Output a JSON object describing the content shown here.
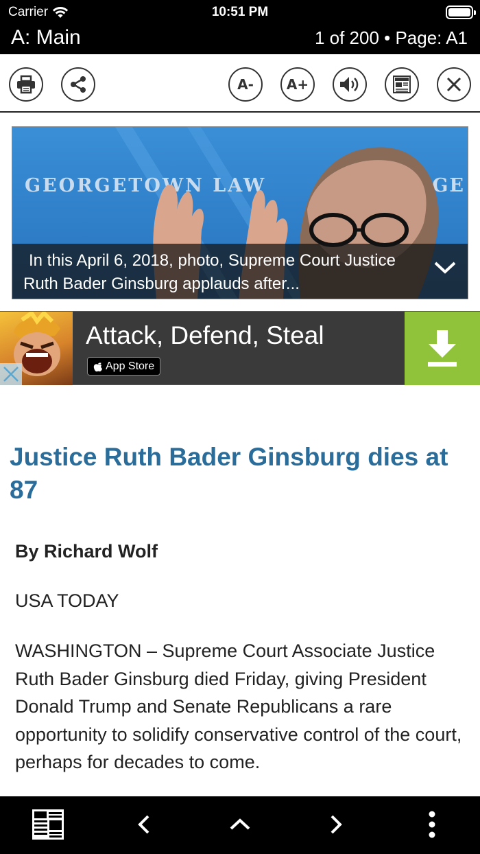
{
  "status_bar": {
    "carrier": "Carrier",
    "time": "10:51 PM"
  },
  "nav": {
    "title": "A: Main",
    "page_info": "1 of 200 • Page: A1"
  },
  "toolbar": {
    "print_icon": "printer-icon",
    "share_icon": "share-icon",
    "font_decrease_label": "A-",
    "font_increase_label": "A+",
    "audio_icon": "speaker-icon",
    "newspaper_icon": "newspaper-icon",
    "close_icon": "close-icon"
  },
  "hero": {
    "image_text_left": "GEORGETOWN LAW",
    "image_text_right": "ORGE",
    "caption": "In this April 6, 2018, photo, Supreme Court Justice Ruth Bader Ginsburg applauds after..."
  },
  "ad": {
    "title": "Attack, Defend, Steal",
    "store_label": "App Store"
  },
  "article": {
    "headline": "Justice Ruth Bader Ginsburg dies at 87",
    "byline": "By Richard Wolf",
    "source": "USA TODAY",
    "body": "WASHINGTON – Supreme Court Associate Justice Ruth Bader Ginsburg died Friday, giving President Donald Trump and Senate Republicans a rare opportunity to solidify conservative control of the court, perhaps for decades to come."
  },
  "bottom_bar": {
    "items": [
      "newspaper-icon",
      "chevron-left-icon",
      "chevron-up-icon",
      "chevron-right-icon",
      "more-vertical-icon"
    ]
  },
  "colors": {
    "headline": "#2a6d9a",
    "ad_download": "#90c23a",
    "bar_background": "#000000"
  }
}
